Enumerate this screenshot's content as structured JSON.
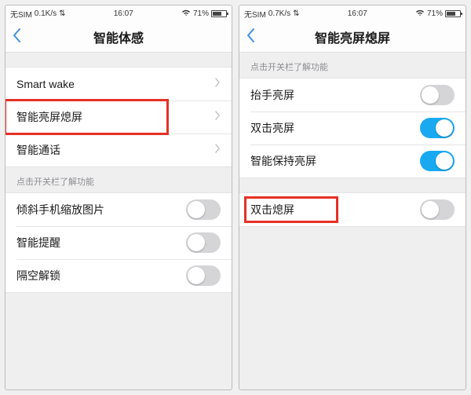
{
  "left": {
    "status": {
      "sim": "无SIM",
      "net": "0.1K/s",
      "time": "16:07",
      "battery_pct": "71%",
      "battery_fill": 71
    },
    "title": "智能体感",
    "rows_nav": [
      {
        "label": "Smart wake"
      },
      {
        "label": "智能亮屏熄屏",
        "highlight": true
      },
      {
        "label": "智能通话"
      }
    ],
    "hint": "点击开关栏了解功能",
    "rows_toggle": [
      {
        "label": "倾斜手机缩放图片",
        "on": false
      },
      {
        "label": "智能提醒",
        "on": false
      },
      {
        "label": "隔空解锁",
        "on": false
      }
    ]
  },
  "right": {
    "status": {
      "sim": "无SIM",
      "net": "0.7K/s",
      "time": "16:07",
      "battery_pct": "71%",
      "battery_fill": 71
    },
    "title": "智能亮屏熄屏",
    "hint": "点击开关栏了解功能",
    "group1": [
      {
        "label": "抬手亮屏",
        "on": false
      },
      {
        "label": "双击亮屏",
        "on": true
      },
      {
        "label": "智能保持亮屏",
        "on": true
      }
    ],
    "group2": [
      {
        "label": "双击熄屏",
        "on": false,
        "highlight": true
      }
    ]
  }
}
